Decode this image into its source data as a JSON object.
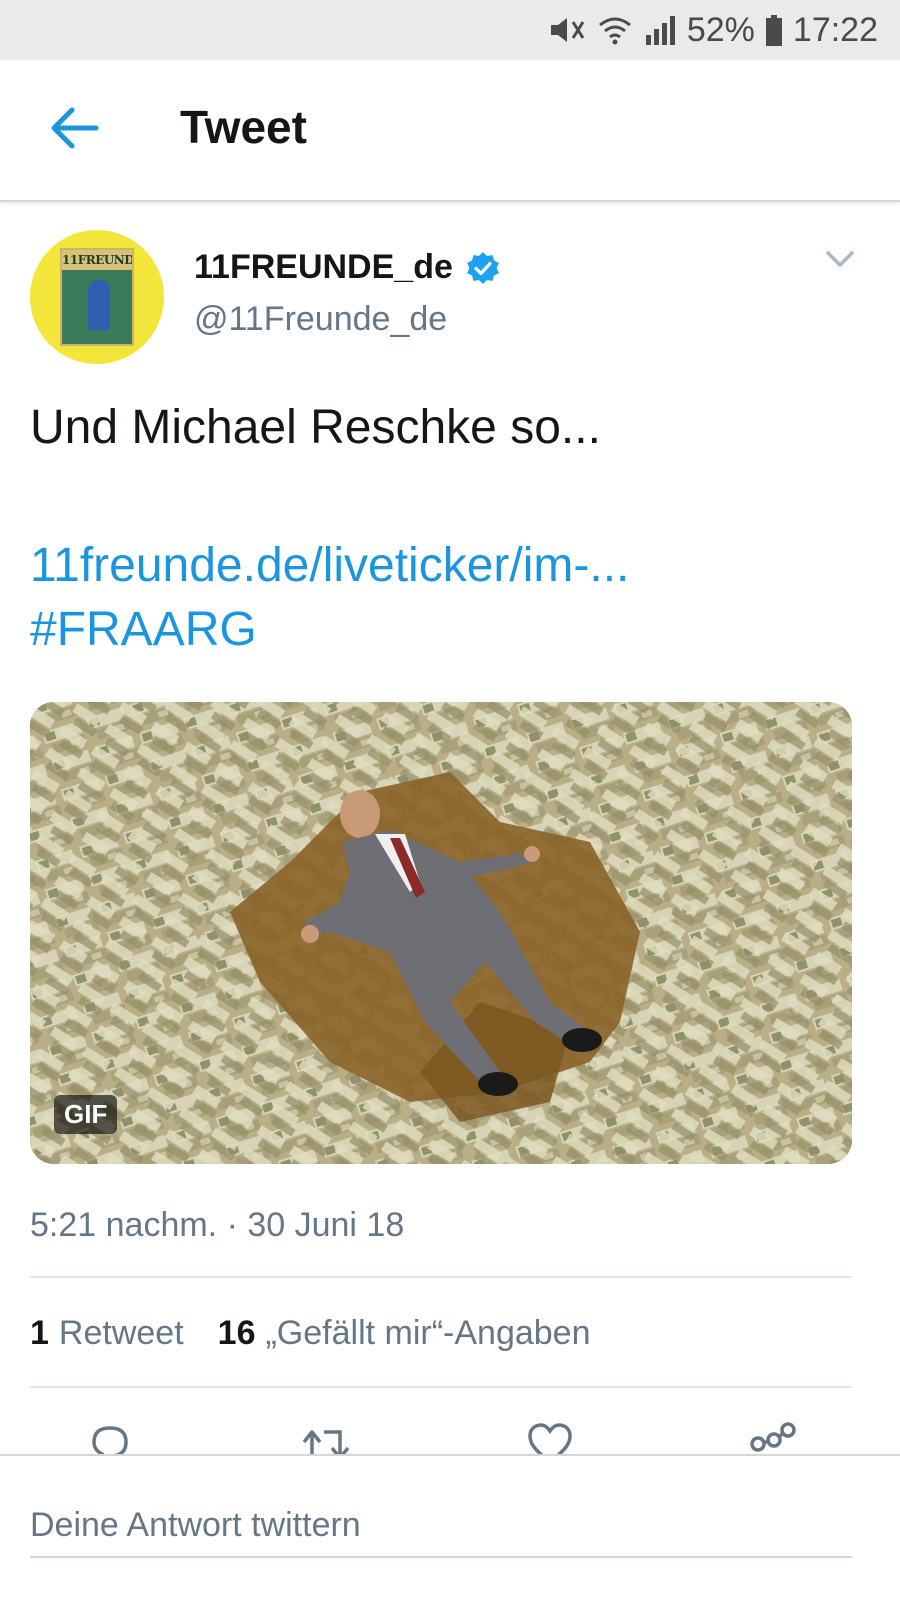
{
  "status_bar": {
    "battery": "52%",
    "time": "17:22",
    "icons": [
      "mute-icon",
      "wifi-icon",
      "signal-icon",
      "battery-icon"
    ]
  },
  "app_bar": {
    "title": "Tweet",
    "back_icon": "arrow-left-icon"
  },
  "tweet": {
    "avatar_text": "11FREUNDE",
    "display_name": "11FREUNDE_de",
    "handle": "@11Freunde_de",
    "verified": true,
    "text": "Und Michael Reschke so...",
    "link": "11freunde.de/liveticker/im-...",
    "hashtag": "#FRAARG",
    "media_badge": "GIF",
    "timestamp": "5:21 nachm. · 30 Juni 18",
    "stats": {
      "retweets_count": "1",
      "retweets_label": "Retweet",
      "likes_count": "16",
      "likes_label": "„Gefällt mir“-Angaben"
    },
    "actions": [
      "reply-icon",
      "retweet-icon",
      "like-icon",
      "share-icon"
    ]
  },
  "reply": {
    "placeholder": "Deine Antwort twittern"
  },
  "colors": {
    "accent": "#1b95e0",
    "secondary_text": "#657786",
    "avatar_bg": "#f3e53a",
    "verified": "#1da1f2"
  }
}
